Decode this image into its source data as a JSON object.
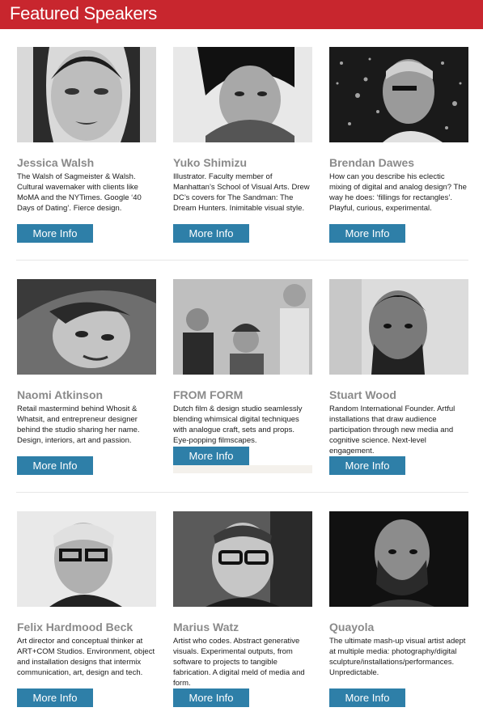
{
  "header": {
    "title": "Featured Speakers",
    "color": "#c8262e"
  },
  "button_color": "#2e7fa8",
  "speakers": [
    {
      "name": "Jessica Walsh",
      "description": "The Walsh of Sagmeister & Walsh. Cultural wavemaker with clients like MoMA and the NYTimes. Google ‘40 Days of Dating’. Fierce design.",
      "button": "More Info"
    },
    {
      "name": "Yuko Shimizu",
      "description": "Illustrator. Faculty member of Manhattan’s School of Visual Arts. Drew DC’s covers for The Sandman: The Dream Hunters. Inimitable visual style.",
      "button": "More Info"
    },
    {
      "name": "Brendan Dawes",
      "description": "How can you describe his eclectic mixing of digital and analog design? The way he does: ‘fillings for rectangles’. Playful, curious, experimental.",
      "button": "More Info"
    },
    {
      "name": "Naomi Atkinson",
      "description": "Retail mastermind behind Whosit & Whatsit, and entrepreneur designer behind the studio sharing her name. Design, interiors, art and passion.",
      "button": "More Info"
    },
    {
      "name": "FROM FORM",
      "description": "Dutch film & design studio seamlessly blending whimsical digital techniques with analogue craft, sets and props. Eye-popping filmscapes.",
      "button": "More Info"
    },
    {
      "name": "Stuart Wood",
      "description": "Random International Founder. Artful installations that draw audience participation through new media and cognitive science. Next-level engagement.",
      "button": "More Info"
    },
    {
      "name": "Felix Hardmood Beck",
      "description": "Art director and conceptual thinker at ART+COM Studios. Environment, object and installation designs that intermix communication, art, design and tech.",
      "button": "More Info"
    },
    {
      "name": "Marius Watz",
      "description": "Artist who codes. Abstract generative visuals. Experimental outputs, from software to projects to tangible fabrication. A digital meld of media and form.",
      "button": "More Info"
    },
    {
      "name": "Quayola",
      "description": "The ultimate mash-up visual artist adept at multiple media: photography/digital sculpture/installations/performances. Unpredictable.",
      "button": "More Info"
    }
  ]
}
